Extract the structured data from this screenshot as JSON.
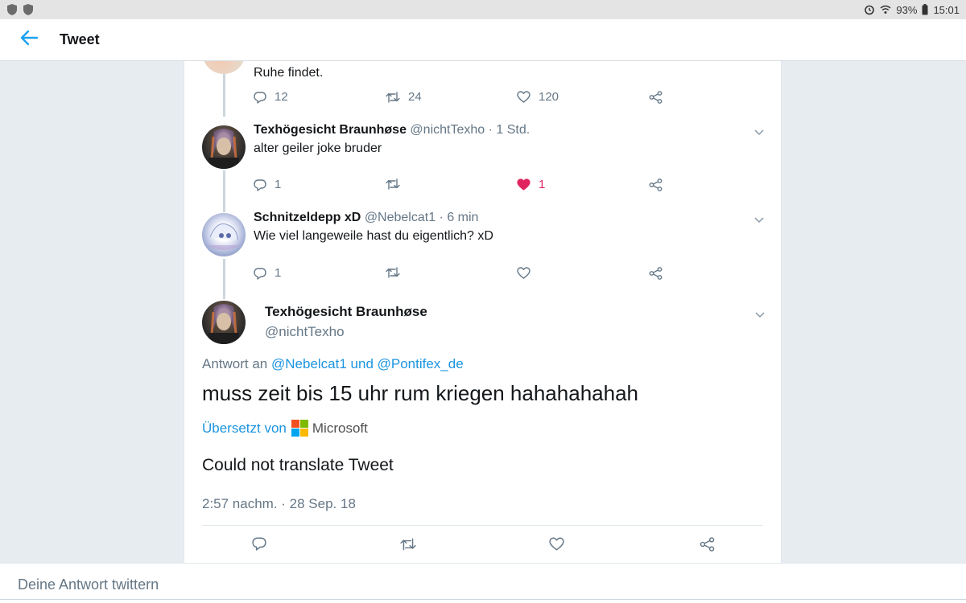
{
  "statusbar": {
    "battery": "93%",
    "time": "15:01"
  },
  "appbar": {
    "title": "Tweet"
  },
  "tweets": [
    {
      "text": "Ruhe findet.",
      "actions": {
        "reply": "12",
        "retweet": "24",
        "like": "120"
      }
    },
    {
      "name": "Texhögesicht Braunhøse",
      "meta": "@nichtTexho · 1 Std.",
      "text": "alter geiler joke bruder",
      "actions": {
        "reply": "1",
        "retweet": "",
        "like": "1"
      },
      "liked": true
    },
    {
      "name": "Schnitzeldepp xD",
      "meta": "@Nebelcat1 · 6 min",
      "text": "Wie viel langeweile hast du eigentlich? xD",
      "actions": {
        "reply": "1",
        "retweet": "",
        "like": ""
      }
    }
  ],
  "main_tweet": {
    "name": "Texhögesicht Braunhøse",
    "handle": "@nichtTexho",
    "reply_prefix": "Antwort an ",
    "reply_user1": "@Nebelcat1",
    "reply_and": " und ",
    "reply_user2": "@Pontifex_de",
    "text": "muss zeit bis 15 uhr rum kriegen hahahahahah",
    "translated_by": "Übersetzt von",
    "translator": "Microsoft",
    "translation": "Could not translate Tweet",
    "timestamp": "2:57 nachm. · 28 Sep. 18"
  },
  "reply_box": {
    "placeholder": "Deine Antwort twittern"
  },
  "colors": {
    "accent": "#1da1f2",
    "like": "#e0245e",
    "muted": "#657786"
  },
  "icons": [
    "shield-icon",
    "alarm-icon",
    "wifi-icon",
    "battery-icon",
    "back-arrow-icon",
    "reply-icon",
    "retweet-icon",
    "heart-icon",
    "share-icon",
    "chevron-down-icon",
    "microsoft-logo"
  ]
}
